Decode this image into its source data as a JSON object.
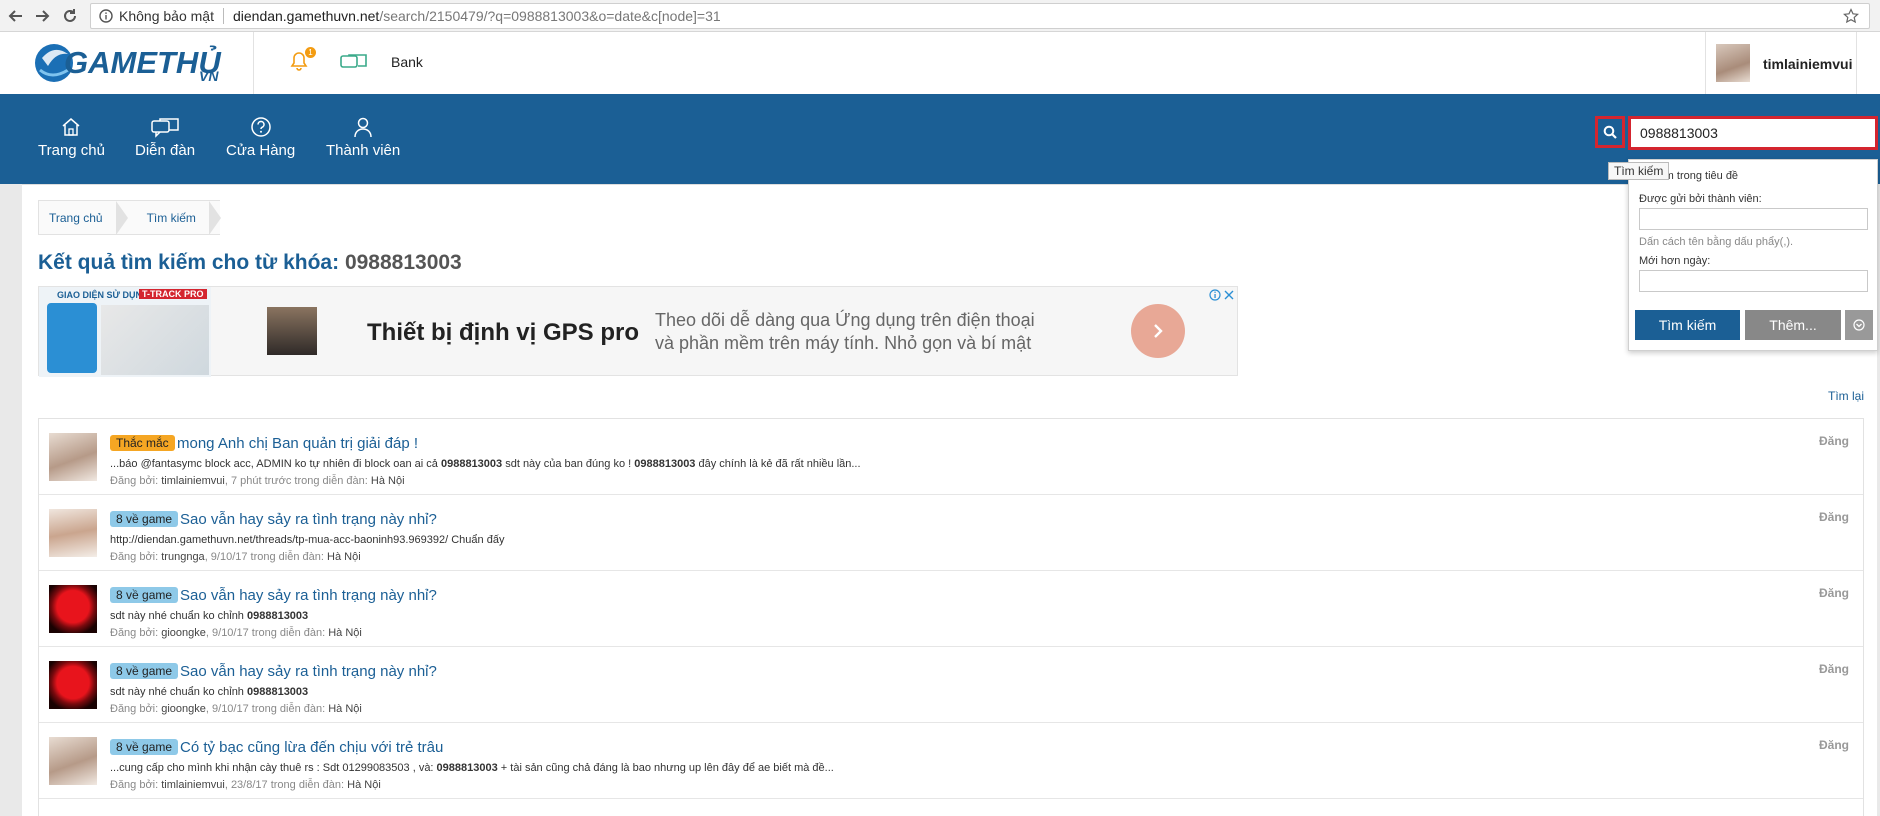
{
  "browser": {
    "insecure_label": "Không bảo mật",
    "url_host": "diendan.gamethuvn.net",
    "url_path": "/search/2150479/?q=0988813003&o=date&c[node]=31"
  },
  "header": {
    "logo_text": "GAMETHỦ",
    "logo_suffix": "VN",
    "notification_count": "1",
    "bank_label": "Bank",
    "username": "timlainiemvui"
  },
  "nav": {
    "items": [
      {
        "label": "Trang chủ",
        "icon": "home-icon"
      },
      {
        "label": "Diễn đàn",
        "icon": "chat-bubbles-icon"
      },
      {
        "label": "Cửa Hàng",
        "icon": "question-circle-icon"
      },
      {
        "label": "Thành viên",
        "icon": "user-icon"
      }
    ]
  },
  "search": {
    "value": "0988813003",
    "tooltip": "Tìm kiếm",
    "title_only_label": "Chỉ tìm trong tiêu đề",
    "posted_by_label": "Được gửi bởi thành viên:",
    "separator_hint": "Dấn cách tên bằng dấu phẩy(,).",
    "newer_than_label": "Mới hơn ngày:",
    "submit_label": "Tìm kiếm",
    "more_label": "Thêm..."
  },
  "breadcrumb": [
    "Trang chủ",
    "Tìm kiếm"
  ],
  "page": {
    "title_prefix": "Kết quả tìm kiếm cho từ khóa:",
    "keyword": "0988813003",
    "retry_label": "Tìm lại"
  },
  "ad": {
    "tag_left": "GIAO DIỆN  SỬ DỤNG",
    "tag_right": "T-TRACK PRO",
    "headline": "Thiết bị định vị GPS pro",
    "desc_line1": "Theo dõi dễ dàng qua Ứng dụng trên điện thoại",
    "desc_line2": "và phần mềm trên máy tính. Nhỏ gọn và bí mật"
  },
  "results": [
    {
      "prefix": "Thắc mắc",
      "prefix_color": "#f5a623",
      "title": "mong Anh chị Ban quản trị giải đáp !",
      "snippet_a": "...báo @fantasymc block acc, ADMIN ko tự nhiên đi block oan ai cả ",
      "snippet_b": "0988813003",
      "snippet_c": " sdt này của ban đúng ko ! ",
      "snippet_d": "0988813003",
      "snippet_e": " đây chính là kẻ đã rất nhiều lần...",
      "meta_label": "Đăng bởi: ",
      "author": "timlainiemvui",
      "meta_mid": ", 7 phút trước trong diễn đàn: ",
      "forum": "Hà Nội",
      "right": "Đăng"
    },
    {
      "prefix": "8 về game",
      "prefix_color": "#8ec9e8",
      "title": "Sao vẫn hay sảy ra tình trạng này nhỉ?",
      "snippet_a": "http://diendan.gamethuvn.net/threads/tp-mua-acc-baoninh93.969392/ Chuẩn đấy",
      "snippet_b": "",
      "snippet_c": "",
      "snippet_d": "",
      "snippet_e": "",
      "meta_label": "Đăng bởi: ",
      "author": "trungnga",
      "meta_mid": ", 9/10/17 trong diễn đàn: ",
      "forum": "Hà Nội",
      "right": "Đăng"
    },
    {
      "prefix": "8 về game",
      "prefix_color": "#8ec9e8",
      "title": "Sao vẫn hay sảy ra tình trạng này nhỉ?",
      "snippet_a": "sdt này nhé chuẩn ko chỉnh ",
      "snippet_b": "0988813003",
      "snippet_c": "",
      "snippet_d": "",
      "snippet_e": "",
      "meta_label": "Đăng bởi: ",
      "author": "gioongke",
      "meta_mid": ", 9/10/17 trong diễn đàn: ",
      "forum": "Hà Nội",
      "right": "Đăng"
    },
    {
      "prefix": "8 về game",
      "prefix_color": "#8ec9e8",
      "title": "Sao vẫn hay sảy ra tình trạng này nhỉ?",
      "snippet_a": "sdt này nhé chuẩn ko chỉnh ",
      "snippet_b": "0988813003",
      "snippet_c": "",
      "snippet_d": "",
      "snippet_e": "",
      "meta_label": "Đăng bởi: ",
      "author": "gioongke",
      "meta_mid": ", 9/10/17 trong diễn đàn: ",
      "forum": "Hà Nội",
      "right": "Đăng"
    },
    {
      "prefix": "8 về game",
      "prefix_color": "#8ec9e8",
      "title": "Có tỷ bạc cũng lừa đến chịu với trẻ trâu",
      "snippet_a": "...cung cấp cho mình khi nhận cày thuê rs : Sdt 01299083503 , và: ",
      "snippet_b": "0988813003",
      "snippet_c": " + tài sản cũng chả đáng là bao nhưng up lên đây để ae biết mà đề...",
      "snippet_d": "",
      "snippet_e": "",
      "meta_label": "Đăng bởi: ",
      "author": "timlainiemvui",
      "meta_mid": ", 23/8/17 trong diễn đàn: ",
      "forum": "Hà Nội",
      "right": "Đăng"
    }
  ],
  "colors": {
    "brand_blue": "#1b5f95",
    "highlight_red": "#d4252f"
  }
}
